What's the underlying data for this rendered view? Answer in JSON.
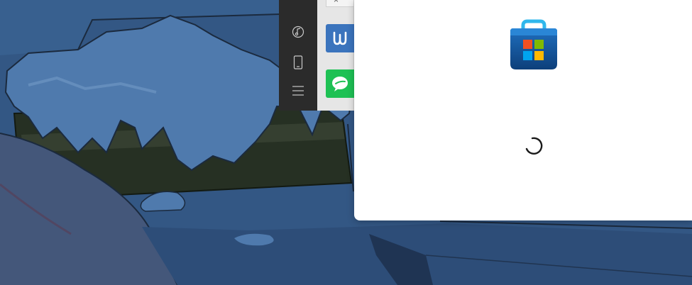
{
  "wallpaper": {
    "icon": "anime-night-snow-scene",
    "colors": {
      "base": "#335784",
      "shadow": "#22354f",
      "snow": "#4e79ad",
      "dark": "#2a3226"
    }
  },
  "launcher": {
    "close_glyph": "×",
    "rail_icons": [
      {
        "name": "music-note-icon"
      },
      {
        "name": "phone-icon"
      },
      {
        "name": "menu-icon"
      }
    ],
    "apps": [
      {
        "name": "w-app-icon",
        "color": "#3b74bd"
      },
      {
        "name": "wechat-icon",
        "color": "#1ec154"
      }
    ]
  },
  "store_splash": {
    "logo": "microsoft-store-icon",
    "logo_colors": [
      "#f25022",
      "#7fba00",
      "#00a4ef",
      "#ffb900"
    ],
    "loading": true
  }
}
